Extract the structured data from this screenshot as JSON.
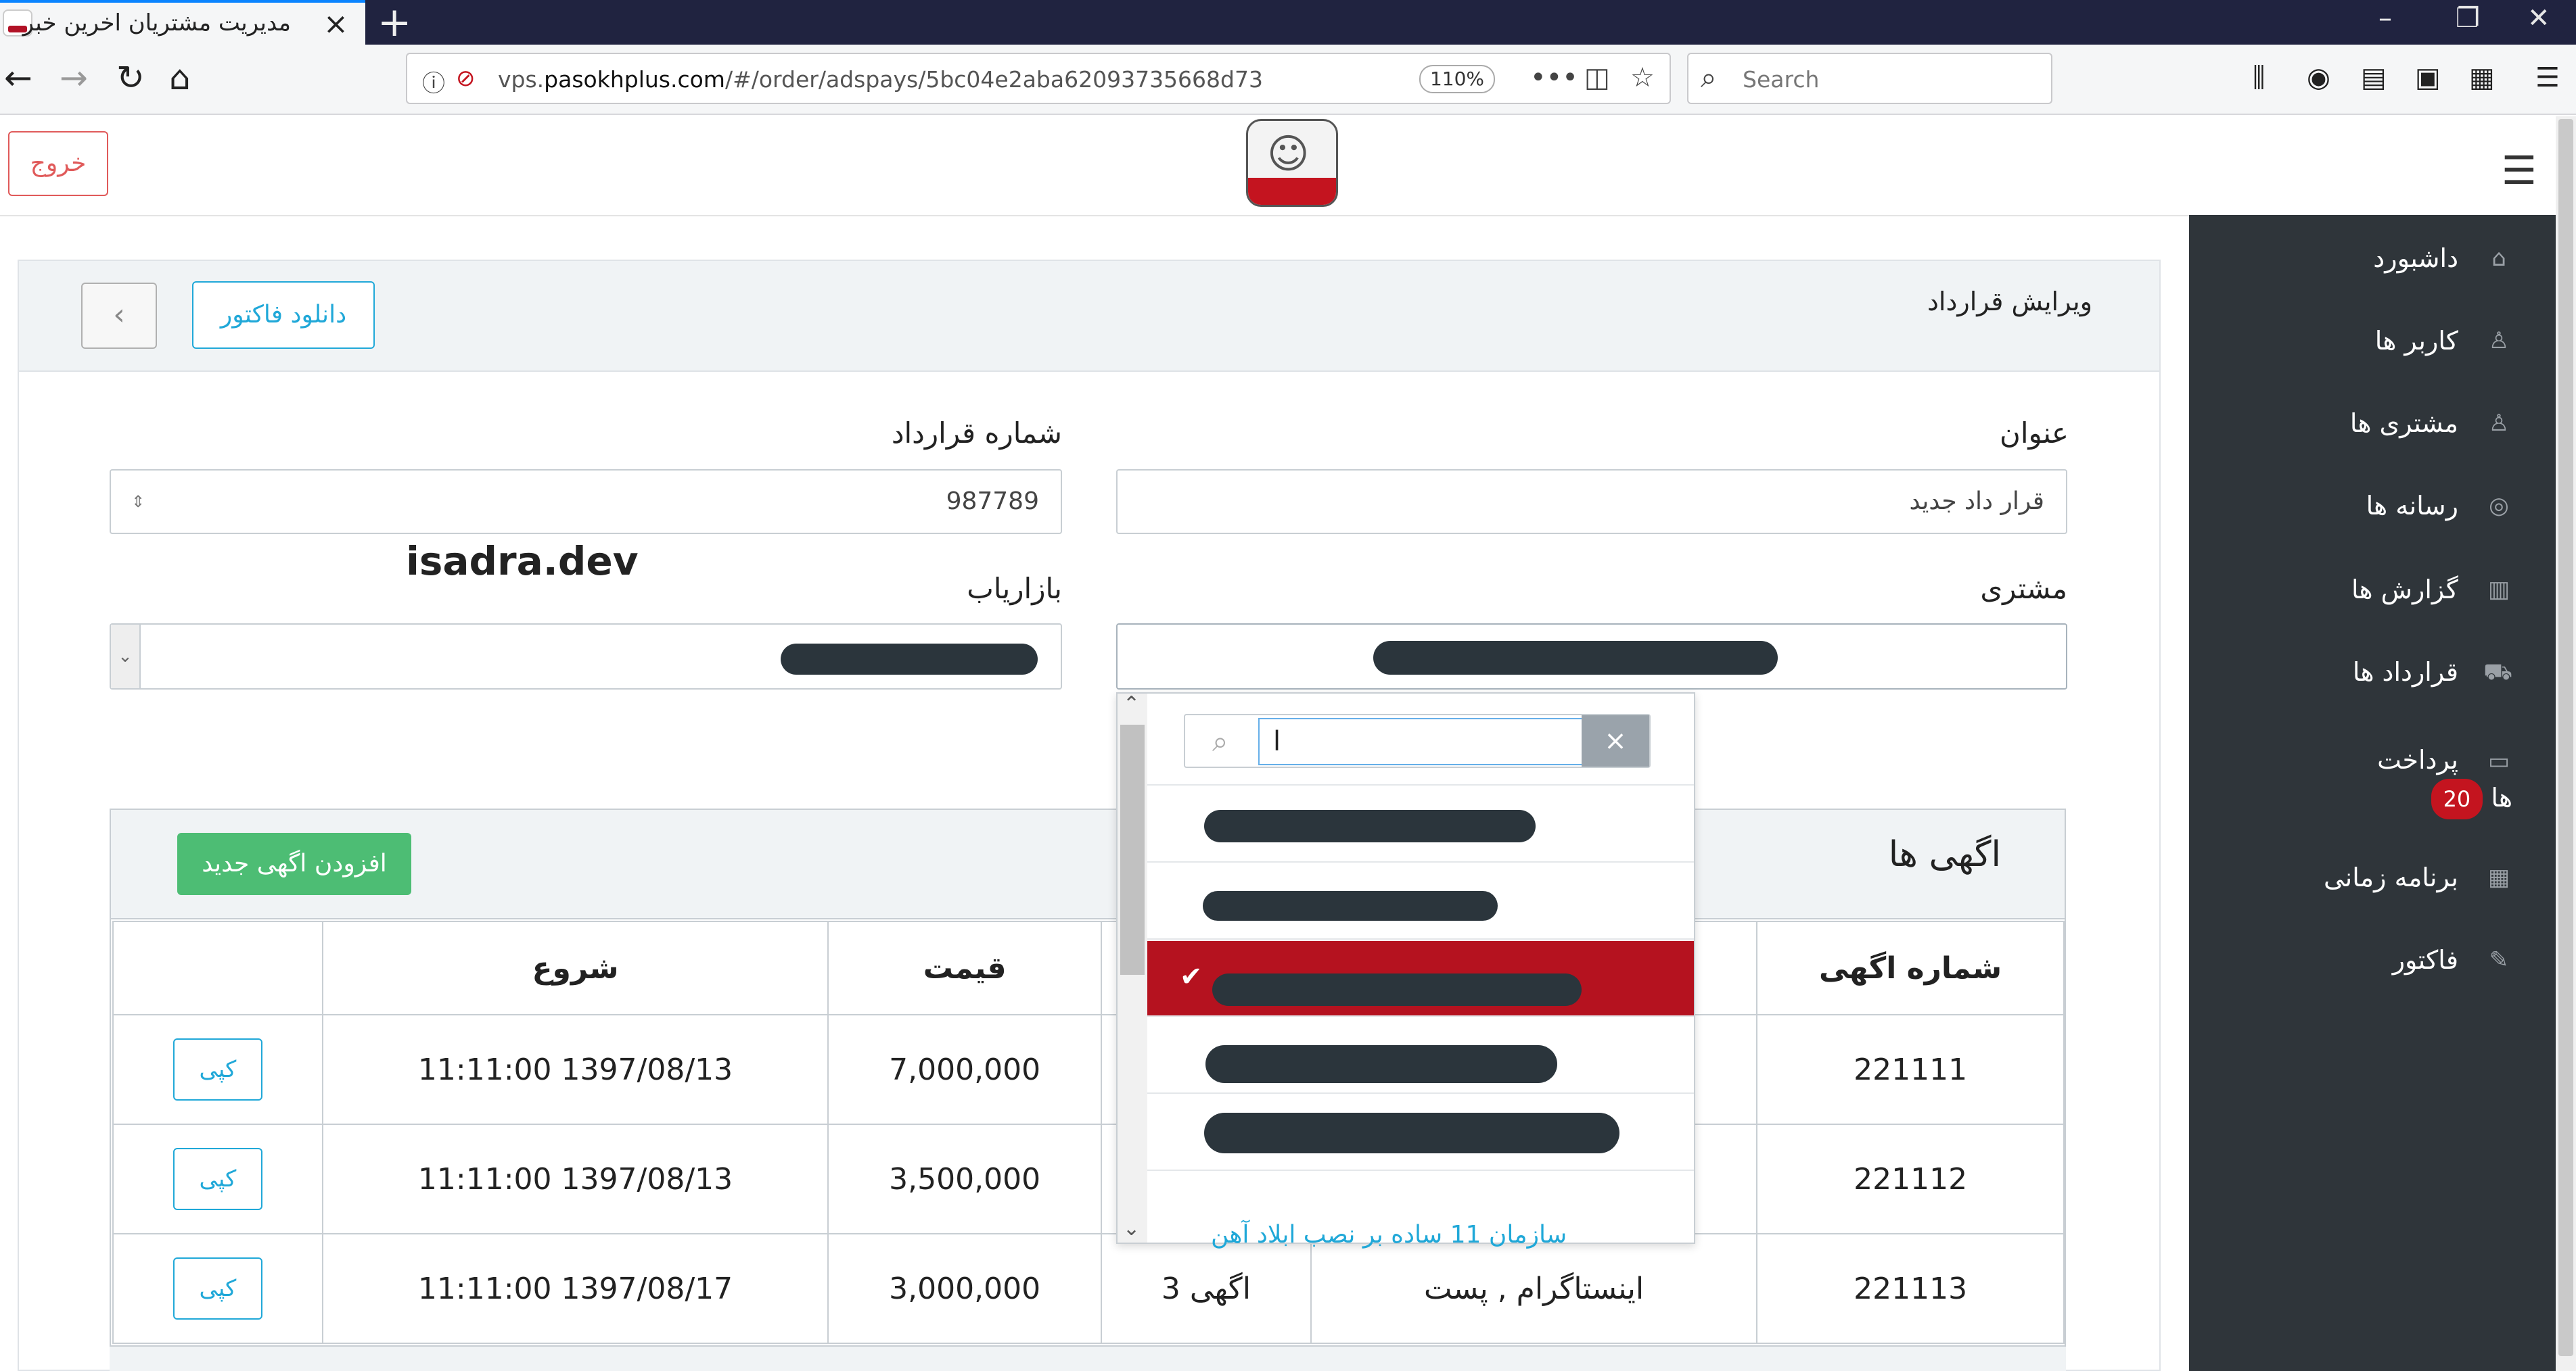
{
  "browser": {
    "tab_title": "مدیریت مشتریان اخرین خبر",
    "new_tab": "+",
    "url_prefix": "vps.",
    "url_domain": "pasokhplus.com",
    "url_path": "/#/order/adspays/5bc04e2aba62093735668d73",
    "zoom": "110%",
    "search_placeholder": "Search"
  },
  "header": {
    "logout_label": "خروج"
  },
  "sidebar": {
    "items": [
      {
        "label": "داشبورد",
        "icon": "home-icon"
      },
      {
        "label": "کاربر ها",
        "icon": "user-icon"
      },
      {
        "label": "مشتری ها",
        "icon": "users-icon"
      },
      {
        "label": "رسانه ها",
        "icon": "instagram-icon"
      },
      {
        "label": "گزارش ها",
        "icon": "book-icon"
      },
      {
        "label": "قرارداد ها",
        "icon": "cart-icon"
      },
      {
        "label": "پرداخت",
        "label2": "ها",
        "badge": "20",
        "icon": "credit-card-icon"
      },
      {
        "label": "برنامه زمانی",
        "icon": "calendar-icon"
      },
      {
        "label": "فاکتور",
        "icon": "edit-icon"
      }
    ]
  },
  "page": {
    "title": "ویرایش قرارداد",
    "download_invoice": "دانلود فاکتور",
    "back_icon": "chevron-left-icon"
  },
  "form": {
    "title_label": "عنوان",
    "title_value": "قرار داد جدید",
    "contract_number_label": "شماره قرارداد",
    "contract_number_value": "987789",
    "customer_label": "مشتری",
    "marketer_label": "بازاریاب",
    "watermark": "isadra.dev"
  },
  "dropdown": {
    "search_value": "ا",
    "clear": "×",
    "last_item_partial": "سازمان 11 ساده بر نصب ابلاد آهن"
  },
  "ads": {
    "title": "اگهی ها",
    "add_button": "افزودن اگهی جدید",
    "columns": [
      "شماره اگهی",
      "",
      "",
      "قیمت",
      "شروع",
      ""
    ],
    "copy_label": "کپی",
    "rows": [
      {
        "number": "221111",
        "media": "",
        "name": "",
        "price": "7,000,000",
        "start": "1397/08/13 11:11:00"
      },
      {
        "number": "221112",
        "media": "",
        "name": "",
        "price": "3,500,000",
        "start": "1397/08/13 11:11:00"
      },
      {
        "number": "221113",
        "media": "اینستاگرام , پست",
        "name": "اگهی 3",
        "price": "3,000,000",
        "start": "1397/08/17 11:11:00"
      }
    ]
  },
  "colors": {
    "brand_red": "#b5121f",
    "sidebar_bg": "#2f353a",
    "primary": "#20a8d8",
    "success": "#4dbd74"
  }
}
